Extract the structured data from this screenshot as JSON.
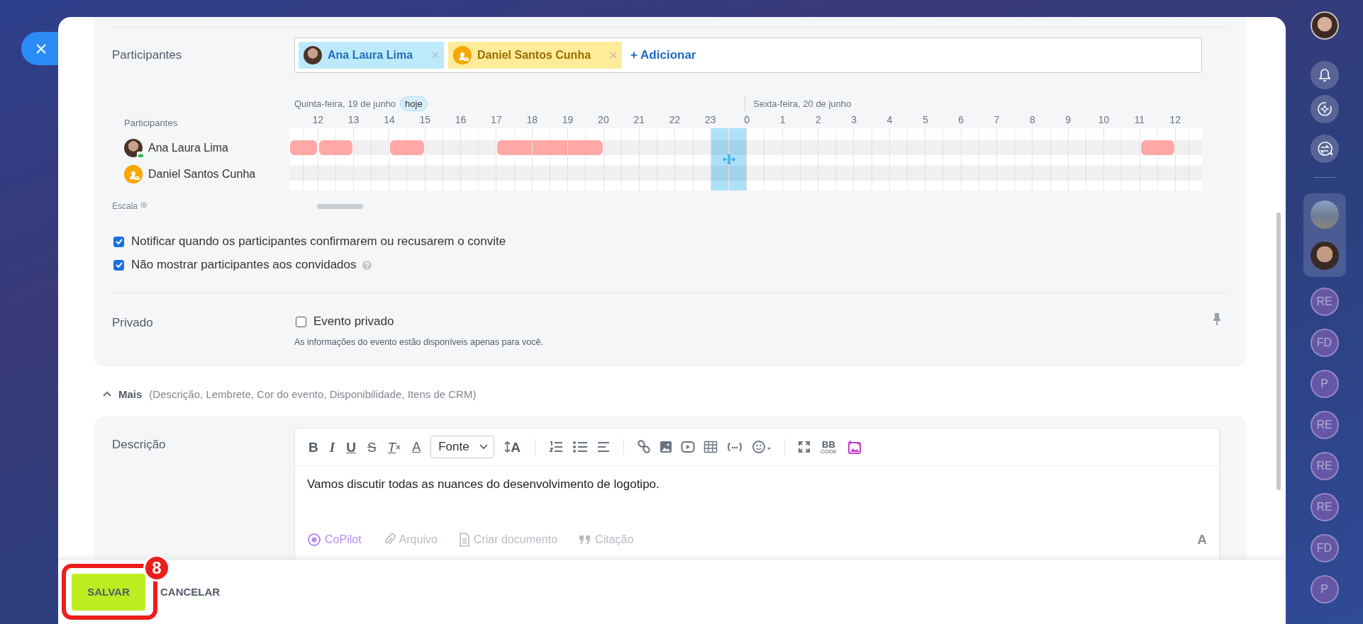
{
  "participants": {
    "label": "Participantes",
    "tags": [
      {
        "name": "Ana Laura Lima",
        "kind": "user"
      },
      {
        "name": "Daniel Santos Cunha",
        "kind": "guest"
      }
    ],
    "add_label": "+ Adicionar"
  },
  "timeline": {
    "label": "Participantes",
    "scale_label": "Escala",
    "days": [
      {
        "label": "Quinta-feira, 19 de junho",
        "today": true,
        "today_label": "hoje",
        "hours": [
          {
            "label": "12",
            "selected": false
          },
          {
            "label": "13",
            "selected": false
          },
          {
            "label": "14",
            "selected": false
          },
          {
            "label": "15",
            "selected": false
          },
          {
            "label": "16",
            "selected": false
          },
          {
            "label": "17",
            "selected": false
          },
          {
            "label": "18",
            "selected": false
          },
          {
            "label": "19",
            "selected": false
          },
          {
            "label": "20",
            "selected": false
          },
          {
            "label": "21",
            "selected": false
          },
          {
            "label": "22",
            "selected": false
          },
          {
            "label": "23",
            "selected": true
          }
        ]
      },
      {
        "label": "Sexta-feira, 20 de junho",
        "today": false,
        "hours": [
          {
            "label": "0",
            "selected": false
          },
          {
            "label": "1",
            "selected": false
          },
          {
            "label": "2",
            "selected": false
          },
          {
            "label": "3",
            "selected": false
          },
          {
            "label": "4",
            "selected": false
          },
          {
            "label": "5",
            "selected": false
          },
          {
            "label": "6",
            "selected": false
          },
          {
            "label": "7",
            "selected": false
          },
          {
            "label": "8",
            "selected": false
          },
          {
            "label": "9",
            "selected": false
          },
          {
            "label": "10",
            "selected": false
          },
          {
            "label": "11",
            "selected": false
          },
          {
            "label": "12",
            "selected": false
          }
        ]
      }
    ],
    "people": [
      {
        "name": "Ana Laura Lima",
        "kind": "user",
        "busy_before": true,
        "busy": [
          true,
          false,
          true,
          false,
          false,
          true,
          true,
          true,
          false,
          false,
          false,
          false,
          false,
          false,
          false,
          false,
          false,
          false,
          false,
          false,
          false,
          false,
          false,
          true,
          false
        ]
      },
      {
        "name": "Daniel Santos Cunha",
        "kind": "guest",
        "busy_before": false,
        "busy": [
          false,
          false,
          false,
          false,
          false,
          false,
          false,
          false,
          false,
          false,
          false,
          false,
          false,
          false,
          false,
          false,
          false,
          false,
          false,
          false,
          false,
          false,
          false,
          false,
          false
        ]
      }
    ]
  },
  "options": [
    {
      "label": "Notificar quando os participantes confirmarem ou recusarem o convite",
      "checked": true,
      "help": false
    },
    {
      "label": "Não mostrar participantes aos convidados",
      "checked": true,
      "help": true
    }
  ],
  "private": {
    "label": "Privado",
    "option": {
      "label": "Evento privado",
      "checked": false
    },
    "hint": "As informações do evento estão disponíveis apenas para você."
  },
  "more": {
    "label": "Mais",
    "details": "(Descrição, Lembrete, Cor do evento, Disponibilidade, Itens de CRM)",
    "expanded": true
  },
  "description": {
    "label": "Descrição",
    "toolbar": [
      {
        "kind": "bold",
        "label": "B"
      },
      {
        "kind": "italic",
        "label": "I"
      },
      {
        "kind": "underline",
        "label": "U"
      },
      {
        "kind": "strike",
        "label": "S"
      },
      {
        "kind": "clear",
        "label": "T"
      },
      {
        "kind": "color",
        "label": "A"
      },
      {
        "kind": "font",
        "label": "Fonte"
      },
      {
        "kind": "size",
        "label": "A"
      },
      {
        "kind": "sep"
      },
      {
        "kind": "numbered"
      },
      {
        "kind": "bulleted"
      },
      {
        "kind": "align"
      },
      {
        "kind": "sep"
      },
      {
        "kind": "link"
      },
      {
        "kind": "image"
      },
      {
        "kind": "video"
      },
      {
        "kind": "table"
      },
      {
        "kind": "code"
      },
      {
        "kind": "emoji"
      },
      {
        "kind": "sep"
      },
      {
        "kind": "fullscreen"
      },
      {
        "kind": "bbcode",
        "label": "BB",
        "sublabel": "CODE"
      },
      {
        "kind": "ai-image"
      }
    ],
    "text": "Vamos discutir todas as nuances do desenvolvimento de logotipo.",
    "actions": [
      {
        "kind": "copilot",
        "label": "CoPilot"
      },
      {
        "kind": "file",
        "label": "Arquivo"
      },
      {
        "kind": "doc",
        "label": "Criar documento"
      },
      {
        "kind": "quote",
        "label": "Citação"
      }
    ],
    "format_label": "A"
  },
  "footer": {
    "save": "SALVAR",
    "cancel": "CANCELAR",
    "callout": "8"
  },
  "sidebar": {
    "recent": [
      {
        "initials": "RE"
      },
      {
        "initials": "FD"
      },
      {
        "initials": "P"
      },
      {
        "initials": "RE"
      },
      {
        "initials": "RE"
      },
      {
        "initials": "RE"
      },
      {
        "initials": "FD"
      },
      {
        "initials": "P"
      }
    ]
  }
}
